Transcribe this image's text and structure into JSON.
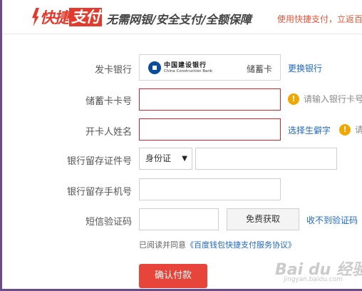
{
  "header": {
    "logo_part1": "快捷",
    "logo_part2": "支付",
    "slogan": "无需网银/安全支付/全额保障",
    "right_text": "使用快捷支付，立返百"
  },
  "form": {
    "bank": {
      "label": "发卡银行",
      "bank_name_cn": "中国建设银行",
      "bank_name_en": "China Construction Bank",
      "card_type": "储蓄卡",
      "change_link": "更换银行"
    },
    "card_number": {
      "label": "储蓄卡卡号",
      "value": "",
      "warning": "请输入银行卡号"
    },
    "holder_name": {
      "label": "开卡人姓名",
      "value": "",
      "rare_char_link": "选择生僻字",
      "warning": "请"
    },
    "id_number": {
      "label": "银行留存证件号",
      "id_type": "身份证",
      "value": ""
    },
    "phone": {
      "label": "银行留存手机号",
      "value": ""
    },
    "sms": {
      "label": "短信验证码",
      "value": "",
      "get_code_button": "免费获取",
      "not_received_link": "收不到验证码"
    },
    "agreement": {
      "prefix": "已阅读并同意",
      "link": "《百度钱包快捷支付服务协议》"
    },
    "confirm_button": "确认付款"
  },
  "watermark": {
    "text": "Bai du 经验",
    "sub": "jingyan.baidu.com"
  },
  "colors": {
    "brand_red": "#e23b2e",
    "error_border": "#d0282f",
    "link_blue": "#1f68c8",
    "warning_orange": "#f2a600",
    "button_red": "#e8453a"
  }
}
